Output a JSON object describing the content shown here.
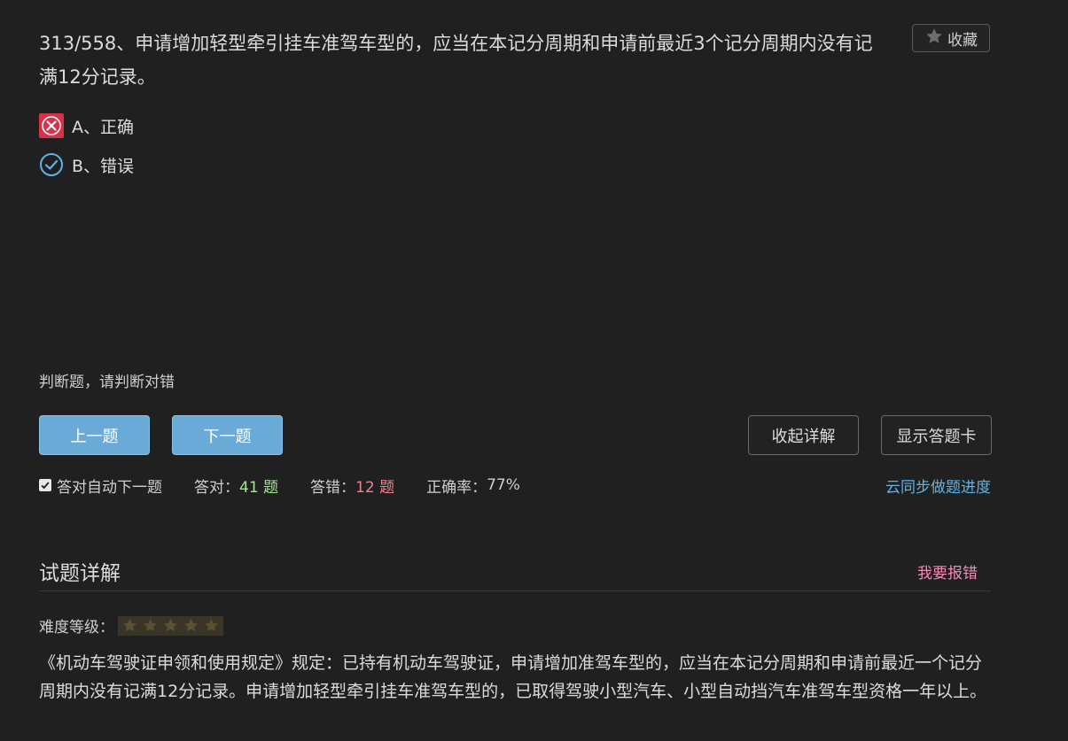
{
  "question": {
    "text": "313/558、申请增加轻型牵引挂车准驾车型的，应当在本记分周期和申请前最近3个记分周期内没有记满12分记录。"
  },
  "favorite": {
    "label": "收藏",
    "icon": "star-icon"
  },
  "options": [
    {
      "label": "A、正确",
      "status": "wrong",
      "icon": "x-mark-icon",
      "color": "#d6324a"
    },
    {
      "label": "B、错误",
      "status": "correct",
      "icon": "check-circle-icon",
      "color": "#5fb3e6"
    }
  ],
  "hint": "判断题，请判断对错",
  "buttons": {
    "prev": "上一题",
    "next": "下一题",
    "collapse": "收起详解",
    "answer_card": "显示答题卡"
  },
  "stats": {
    "auto_next_label": "答对自动下一题",
    "auto_next_checked": true,
    "correct_label": "答对：",
    "correct_value": "41 题",
    "wrong_label": "答错：",
    "wrong_value": "12 题",
    "rate_label": "正确率：",
    "rate_value": "77%"
  },
  "sync_link": "云同步做题进度",
  "detail": {
    "title": "试题详解",
    "report_link": "我要报错",
    "difficulty_label": "难度等级：",
    "difficulty_stars_total": 5,
    "explanation": "《机动车驾驶证申领和使用规定》规定：已持有机动车驾驶证，申请增加准驾车型的，应当在本记分周期和申请前最近一个记分周期内没有记满12分记录。申请增加轻型牵引挂车准驾车型的，已取得驾驶小型汽车、小型自动挡汽车准驾车型资格一年以上。"
  },
  "colors": {
    "background": "#202020",
    "primary_button": "#6aaad6",
    "correct_count": "#a6e39a",
    "wrong_count": "#f0828e",
    "link": "#5fb3e6",
    "report_link": "#f38bb1"
  }
}
